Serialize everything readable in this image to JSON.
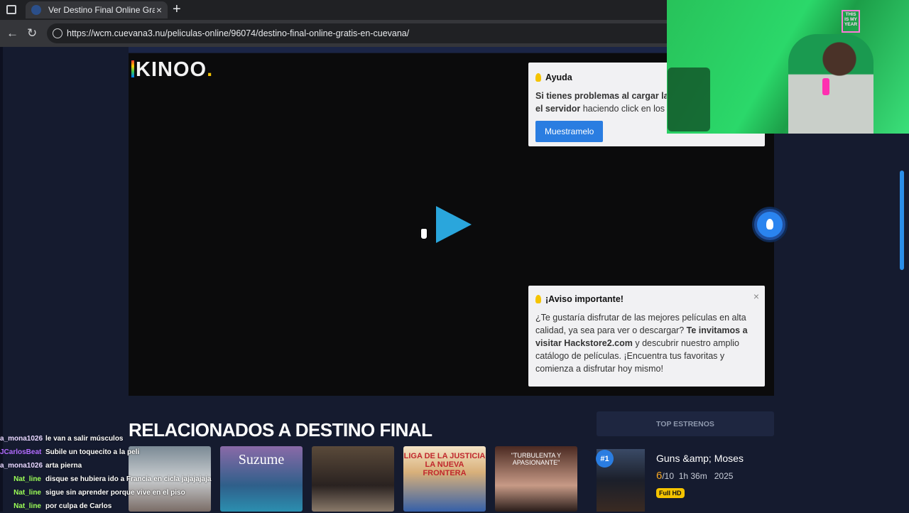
{
  "browser": {
    "tab_title": "Ver Destino Final Online Gratis - C",
    "close_glyph": "×",
    "new_tab_glyph": "+",
    "back_glyph": "←",
    "reload_glyph": "↻",
    "url": "https://wcm.cuevana3.nu/peliculas-online/96074/destino-final-online-gratis-en-cuevana/"
  },
  "player": {
    "logo": "KINOO",
    "logo_dot": ".",
    "play_icon": "play-icon"
  },
  "help_box": {
    "title": "Ayuda",
    "line1_bold": "Si tienes problemas al cargar la pe",
    "line2_bold": "el servidor",
    "line2_rest": " haciendo click en los bo",
    "button": "Muestramelo"
  },
  "notice_box": {
    "title": "¡Aviso importante!",
    "close": "×",
    "text_1": "¿Te gustaría disfrutar de las mejores películas en alta calidad, ya sea para ver o descargar? ",
    "text_bold": "Te invitamos a visitar Hackstore2.com",
    "text_2": " y descubrir nuestro amplio catálogo de películas. ¡Encuentra tus favoritas y comienza a disfrutar hoy mismo!"
  },
  "related": {
    "heading": "RELACIONADOS A DESTINO FINAL",
    "items": [
      {
        "label": ""
      },
      {
        "label": "Suzume"
      },
      {
        "label": ""
      },
      {
        "label": "LIGA DE LA JUSTICIA LA NUEVA FRONTERA"
      },
      {
        "label": "\"TURBULENTA Y APASIONANTE\""
      }
    ]
  },
  "top_estrenos": {
    "header": "TOP ESTRENOS",
    "first": {
      "rank": "#1",
      "title": "Guns &amp; Moses",
      "score": "6",
      "score_max": "/10",
      "duration": "1h 36m",
      "year": "2025",
      "quality": "Full HD"
    }
  },
  "webcam": {
    "neon_sign": "THIS IS MY YEAR"
  },
  "chat": [
    {
      "user": "a_mona1026",
      "msg": "le van a salir músculos",
      "color": "#e9d7ff"
    },
    {
      "user": "JCarlosBeat",
      "msg": "Subile un toquecito a la peli",
      "color": "#b36bff"
    },
    {
      "user": "a_mona1026",
      "msg": "arta pierna",
      "color": "#e9d7ff"
    },
    {
      "user": "Nat_line",
      "msg": "disque se hubiera ido a Francia en cicla jajajajaja",
      "color": "#9cff57"
    },
    {
      "user": "Nat_line",
      "msg": "sigue sin aprender porque vive en el piso",
      "color": "#9cff57"
    },
    {
      "user": "Nat_line",
      "msg": "por culpa de Carlos",
      "color": "#9cff57"
    }
  ]
}
